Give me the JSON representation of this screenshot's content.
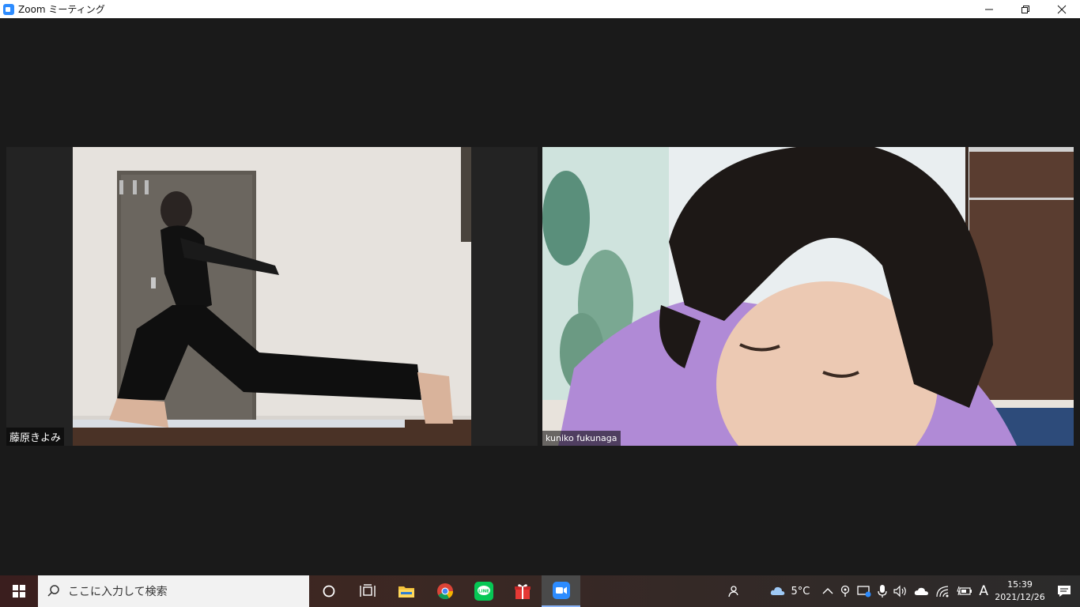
{
  "window": {
    "title": "Zoom ミーティング",
    "minimize": "—",
    "restore": "❐",
    "close": "✕"
  },
  "participants": [
    {
      "name": "藤原きよみ",
      "video": "woman in black doing a low lunge stretch in a room with a door"
    },
    {
      "name": "kuniko fukunaga",
      "video": "close-up of woman with short hair in lavender top looking down"
    }
  ],
  "taskbar": {
    "search_placeholder": "ここに入力して検索",
    "apps": [
      "cortana-icon",
      "task-view-icon",
      "file-explorer-icon",
      "chrome-icon",
      "line-icon",
      "gift-icon",
      "zoom-icon"
    ],
    "active_app": "zoom-icon",
    "weather": "5°C",
    "ime": "A",
    "time": "15:39",
    "date": "2021/12/26"
  },
  "colors": {
    "zoom_blue": "#2d8cff",
    "stage_bg": "#1a1a1a",
    "lavender": "#b08ad6"
  }
}
